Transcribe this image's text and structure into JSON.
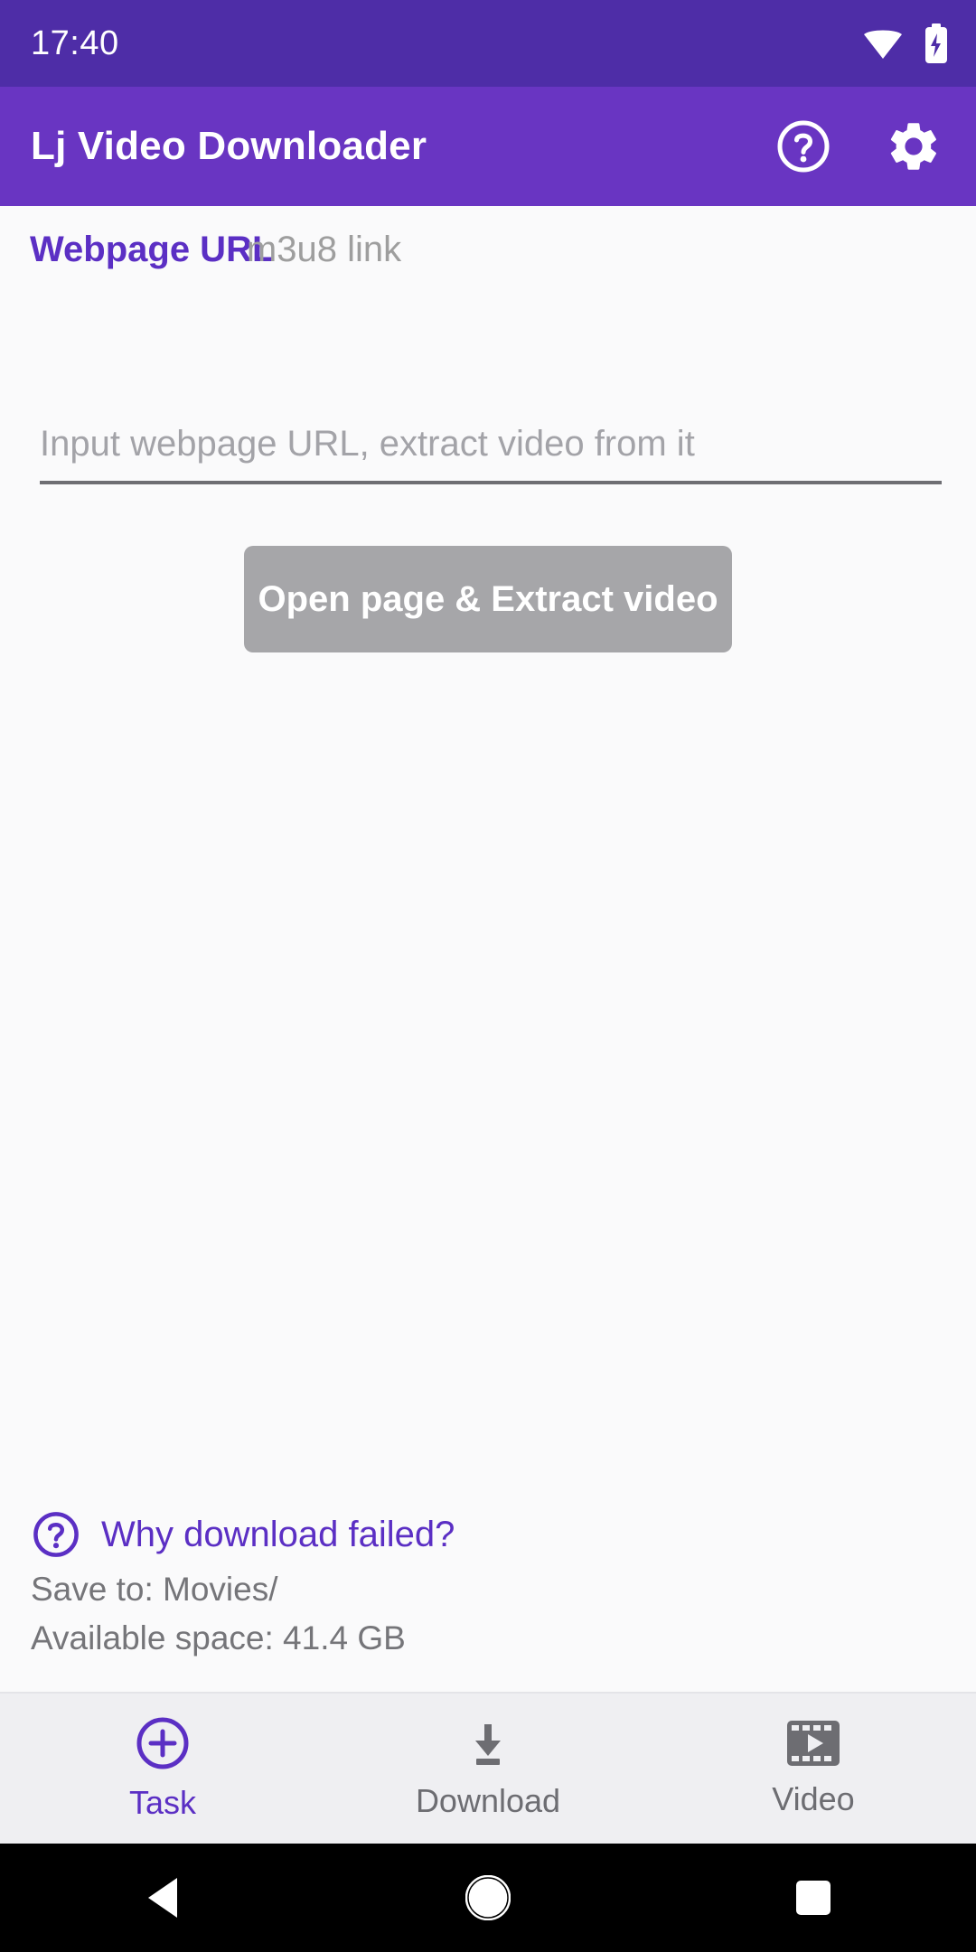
{
  "status_bar": {
    "time": "17:40",
    "icons": [
      "wifi-icon",
      "battery-charging-icon"
    ],
    "background": "#4E2DA7"
  },
  "app_bar": {
    "title": "Lj Video Downloader",
    "background": "#6935C2",
    "actions": [
      {
        "name": "help-icon",
        "label": "Help"
      },
      {
        "name": "settings-gear-icon",
        "label": "Settings"
      }
    ]
  },
  "tabs": {
    "items": [
      {
        "label": "Webpage URL",
        "active": true
      },
      {
        "label": "m3u8 link",
        "active": false
      }
    ],
    "active_color": "#5B2FC4",
    "inactive_color": "#9E9E9E"
  },
  "form": {
    "url_input": {
      "value": "",
      "placeholder": "Input webpage URL, extract video from it"
    },
    "extract_button": {
      "label": "Open page & Extract video",
      "enabled": false,
      "background": "#A6A6A9"
    }
  },
  "footer": {
    "why_failed_link": "Why download failed?",
    "save_to": "Save to: Movies/",
    "available_space": "Available space: 41.4 GB",
    "link_color": "#5B2FC4"
  },
  "bottom_nav": {
    "items": [
      {
        "label": "Task",
        "icon": "plus-circle-icon",
        "active": true
      },
      {
        "label": "Download",
        "icon": "download-icon",
        "active": false
      },
      {
        "label": "Video",
        "icon": "film-play-icon",
        "active": false
      }
    ]
  },
  "system_nav": {
    "items": [
      {
        "name": "back-button",
        "icon": "triangle-left-icon"
      },
      {
        "name": "home-button",
        "icon": "circle-icon"
      },
      {
        "name": "recents-button",
        "icon": "square-icon"
      }
    ]
  }
}
